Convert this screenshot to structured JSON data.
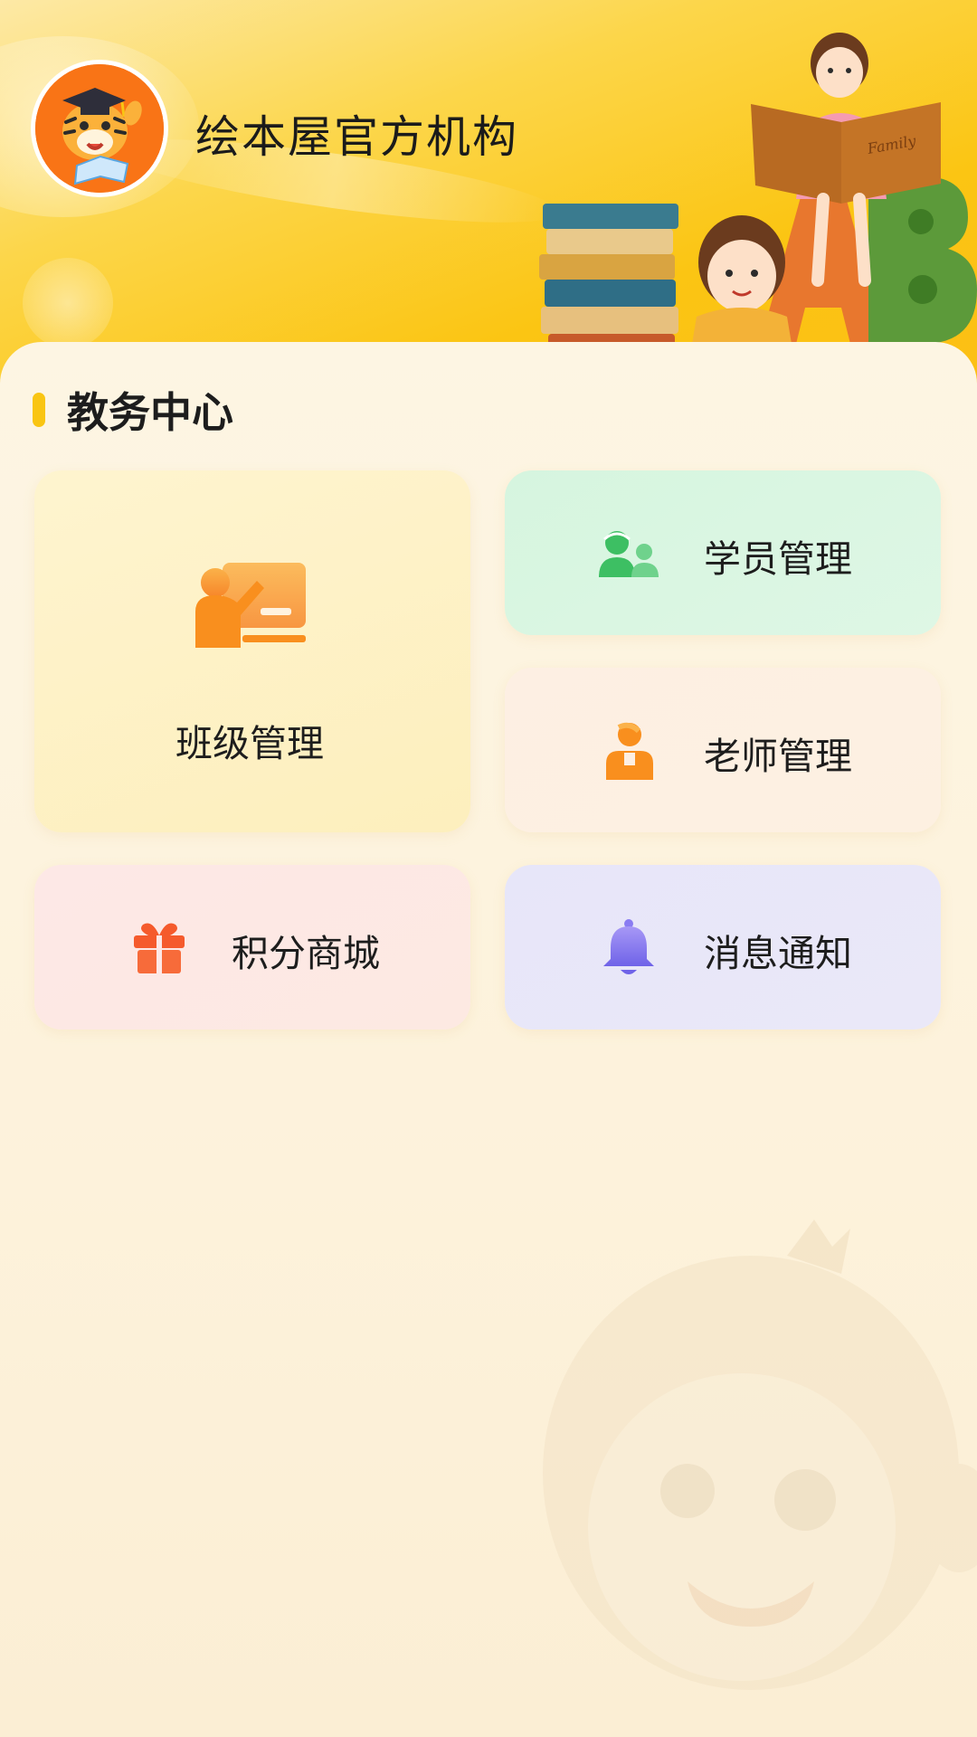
{
  "header": {
    "org_name": "绘本屋官方机构",
    "logo_icon": "tiger-reading-logo-icon",
    "illustration_text": "Family"
  },
  "section": {
    "title": "教务中心"
  },
  "menu": {
    "class_management": {
      "label": "班级管理",
      "icon": "classroom-teacher-icon",
      "color": "#f98f1e"
    },
    "student_management": {
      "label": "学员管理",
      "icon": "students-group-icon",
      "color": "#3dbf63"
    },
    "teacher_management": {
      "label": "老师管理",
      "icon": "teacher-person-icon",
      "color": "#f98f1e"
    },
    "points_mall": {
      "label": "积分商城",
      "icon": "gift-icon",
      "color": "#f55a2c"
    },
    "notifications": {
      "label": "消息通知",
      "icon": "bell-icon",
      "color": "#8a7cf2"
    }
  },
  "colors": {
    "accent": "#f9c513",
    "header_bg": "#fbc513",
    "page_bg": "#fdf3dc"
  }
}
